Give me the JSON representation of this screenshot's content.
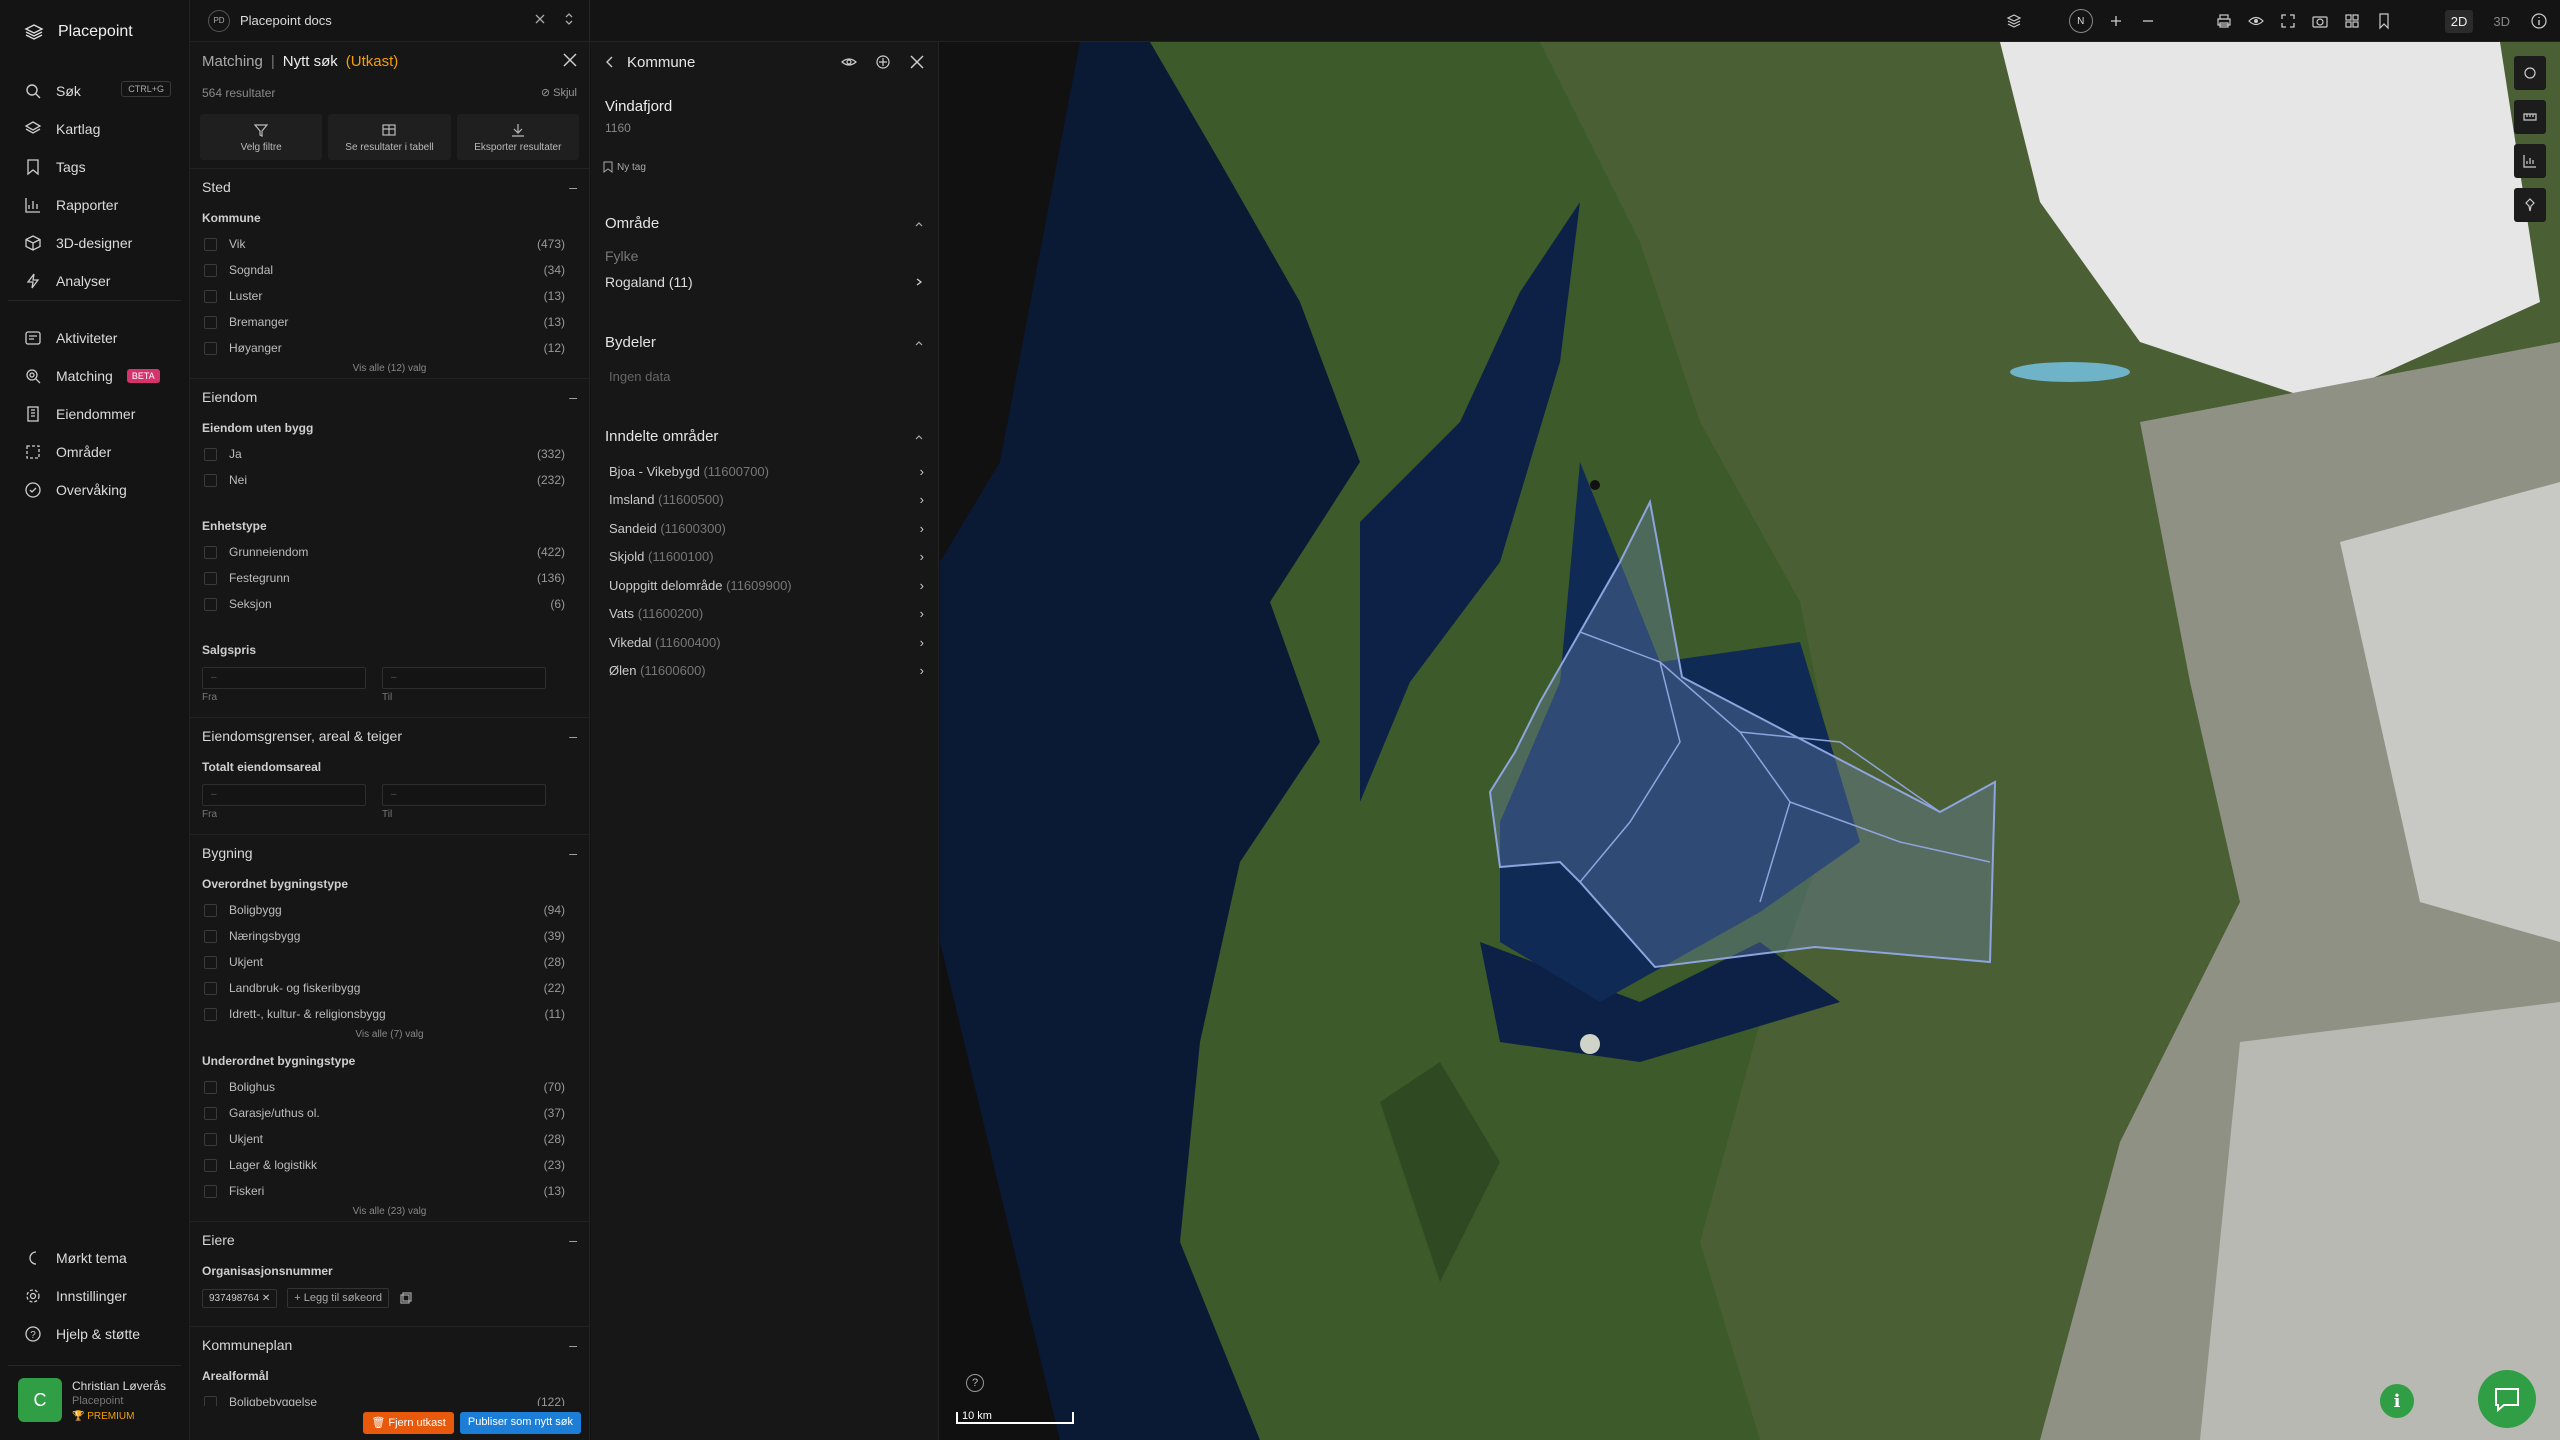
{
  "app": {
    "brand": "Placepoint"
  },
  "nav": {
    "main": [
      {
        "key": "sok",
        "label": "Søk",
        "kbd": "CTRL+G",
        "icon": "search-icon"
      },
      {
        "key": "kartlag",
        "label": "Kartlag",
        "icon": "layers-icon"
      },
      {
        "key": "tags",
        "label": "Tags",
        "icon": "bookmark-icon"
      },
      {
        "key": "rapporter",
        "label": "Rapporter",
        "icon": "chart-icon"
      },
      {
        "key": "3d",
        "label": "3D-designer",
        "icon": "cube-icon"
      },
      {
        "key": "analyser",
        "label": "Analyser",
        "icon": "bolt-icon"
      }
    ],
    "secondary": [
      {
        "key": "aktiviteter",
        "label": "Aktiviteter",
        "icon": "activity-icon"
      },
      {
        "key": "matching",
        "label": "Matching",
        "badge": "BETA",
        "icon": "match-icon"
      },
      {
        "key": "eiendommer",
        "label": "Eiendommer",
        "icon": "building-icon"
      },
      {
        "key": "omrader",
        "label": "Områder",
        "icon": "area-icon"
      },
      {
        "key": "overvaking",
        "label": "Overvåking",
        "icon": "monitor-icon"
      }
    ],
    "bottom": [
      {
        "key": "theme",
        "label": "Mørkt tema",
        "icon": "moon-icon"
      },
      {
        "key": "settings",
        "label": "Innstillinger",
        "icon": "gear-icon"
      },
      {
        "key": "help",
        "label": "Hjelp & støtte",
        "icon": "help-icon"
      }
    ],
    "user": {
      "initial": "C",
      "name": "Christian Løverås",
      "org": "Placepoint",
      "plan": "PREMIUM"
    }
  },
  "topbar": {
    "workspace_badge": "PD",
    "workspace": "Placepoint docs",
    "compass": "N",
    "mode_2d": "2D",
    "mode_3d": "3D"
  },
  "filter": {
    "crumb": "Matching",
    "title": "Nytt søk",
    "status": "(Utkast)",
    "results": "564 resultater",
    "hide": "Skjul",
    "actions": [
      {
        "label": "Velg filtre"
      },
      {
        "label": "Se resultater i tabell"
      },
      {
        "label": "Eksporter resultater"
      }
    ],
    "sted": {
      "title": "Sted",
      "kommune": "Kommune",
      "items": [
        [
          "Vik",
          "(473)"
        ],
        [
          "Sogndal",
          "(34)"
        ],
        [
          "Luster",
          "(13)"
        ],
        [
          "Bremanger",
          "(13)"
        ],
        [
          "Høyanger",
          "(12)"
        ]
      ],
      "more": "Vis alle (12) valg"
    },
    "eiendom": {
      "title": "Eiendom",
      "uten": "Eiendom uten bygg",
      "uten_items": [
        [
          "Ja",
          "(332)"
        ],
        [
          "Nei",
          "(232)"
        ]
      ],
      "enhet": "Enhetstype",
      "enhet_items": [
        [
          "Grunneiendom",
          "(422)"
        ],
        [
          "Festegrunn",
          "(136)"
        ],
        [
          "Seksjon",
          "(6)"
        ]
      ],
      "salgspris": "Salgspris",
      "fra": "Fra",
      "til": "Til",
      "dash": "–"
    },
    "grenser": {
      "title": "Eiendomsgrenser, areal & teiger",
      "areal": "Totalt eiendomsareal",
      "fra": "Fra",
      "til": "Til",
      "dash": "–"
    },
    "bygning": {
      "title": "Bygning",
      "over": "Overordnet bygningstype",
      "over_items": [
        [
          "Boligbygg",
          "(94)"
        ],
        [
          "Næringsbygg",
          "(39)"
        ],
        [
          "Ukjent",
          "(28)"
        ],
        [
          "Landbruk- og fiskeribygg",
          "(22)"
        ],
        [
          "Idrett-, kultur- & religionsbygg",
          "(11)"
        ]
      ],
      "over_more": "Vis alle (7) valg",
      "under": "Underordnet bygningstype",
      "under_items": [
        [
          "Bolighus",
          "(70)"
        ],
        [
          "Garasje/uthus ol.",
          "(37)"
        ],
        [
          "Ukjent",
          "(28)"
        ],
        [
          "Lager & logistikk",
          "(23)"
        ],
        [
          "Fiskeri",
          "(13)"
        ]
      ],
      "under_more": "Vis alle (23) valg"
    },
    "eiere": {
      "title": "Eiere",
      "org": "Organisasjonsnummer",
      "chip": "937498764",
      "add": "Legg til søkeord"
    },
    "kommuneplan": {
      "title": "Kommuneplan",
      "areal": "Arealformål",
      "first": [
        "Boligbebyggelse",
        "(122)"
      ]
    },
    "remove": "Fjern utkast",
    "publish": "Publiser som nytt søk"
  },
  "kommune": {
    "title": "Kommune",
    "name": "Vindafjord",
    "code": "1160",
    "tag": "Ny tag",
    "omrade": "Område",
    "fylke_label": "Fylke",
    "fylke": "Rogaland (11)",
    "bydeler": "Bydeler",
    "bydeler_empty": "Ingen data",
    "inndelte": "Inndelte områder",
    "areas": [
      [
        "Bjoa - Vikebygd",
        "(11600700)"
      ],
      [
        "Imsland",
        "(11600500)"
      ],
      [
        "Sandeid",
        "(11600300)"
      ],
      [
        "Skjold",
        "(11600100)"
      ],
      [
        "Uoppgitt delområde",
        "(11609900)"
      ],
      [
        "Vats",
        "(11600200)"
      ],
      [
        "Vikedal",
        "(11600400)"
      ],
      [
        "Ølen",
        "(11600600)"
      ]
    ]
  },
  "map": {
    "scale": "10 km",
    "help": "?",
    "info": "i"
  },
  "colors": {
    "accent": "#f59f00",
    "primary": "#1c7ed6",
    "danger": "#e8590c",
    "green": "#2f9e44",
    "beta": "#d6336c"
  }
}
